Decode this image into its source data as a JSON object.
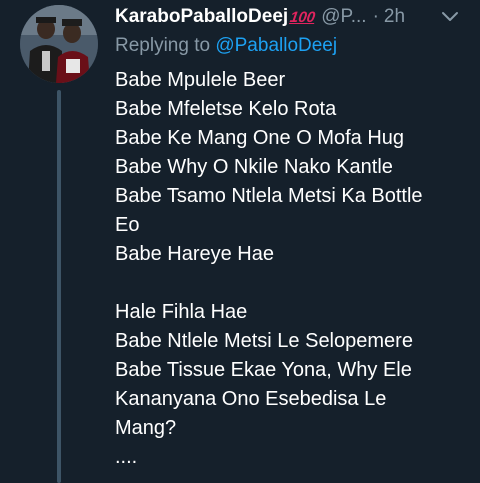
{
  "tweet": {
    "display_name": "KaraboPaballoDeej",
    "emoji": "💯",
    "emoji_text": "100",
    "handle": "@P...",
    "separator": "·",
    "time": "2h",
    "reply_prefix": "Replying to",
    "reply_to": "@PaballoDeej",
    "body_lines": [
      "Babe Mpulele Beer",
      "Babe Mfeletse Kelo Rota",
      "Babe Ke Mang One O Mofa Hug",
      "Babe Why O Nkile Nako Kantle",
      "Babe Tsamo Ntlela Metsi Ka Bottle",
      "Eo",
      "Babe Hareye Hae",
      "",
      "Hale Fihla Hae",
      "Babe Ntlele Metsi Le Selopemere",
      "Babe Tissue Ekae Yona, Why Ele",
      "Kananyana Ono Esebedisa Le",
      "Mang?",
      "...."
    ],
    "icons": {
      "avatar": "avatar-photo",
      "caret": "chevron-down-icon"
    },
    "colors": {
      "background": "#15202b",
      "secondary_text": "#8899a6",
      "link": "#1da1f2",
      "thread_line": "#3d5466"
    }
  }
}
